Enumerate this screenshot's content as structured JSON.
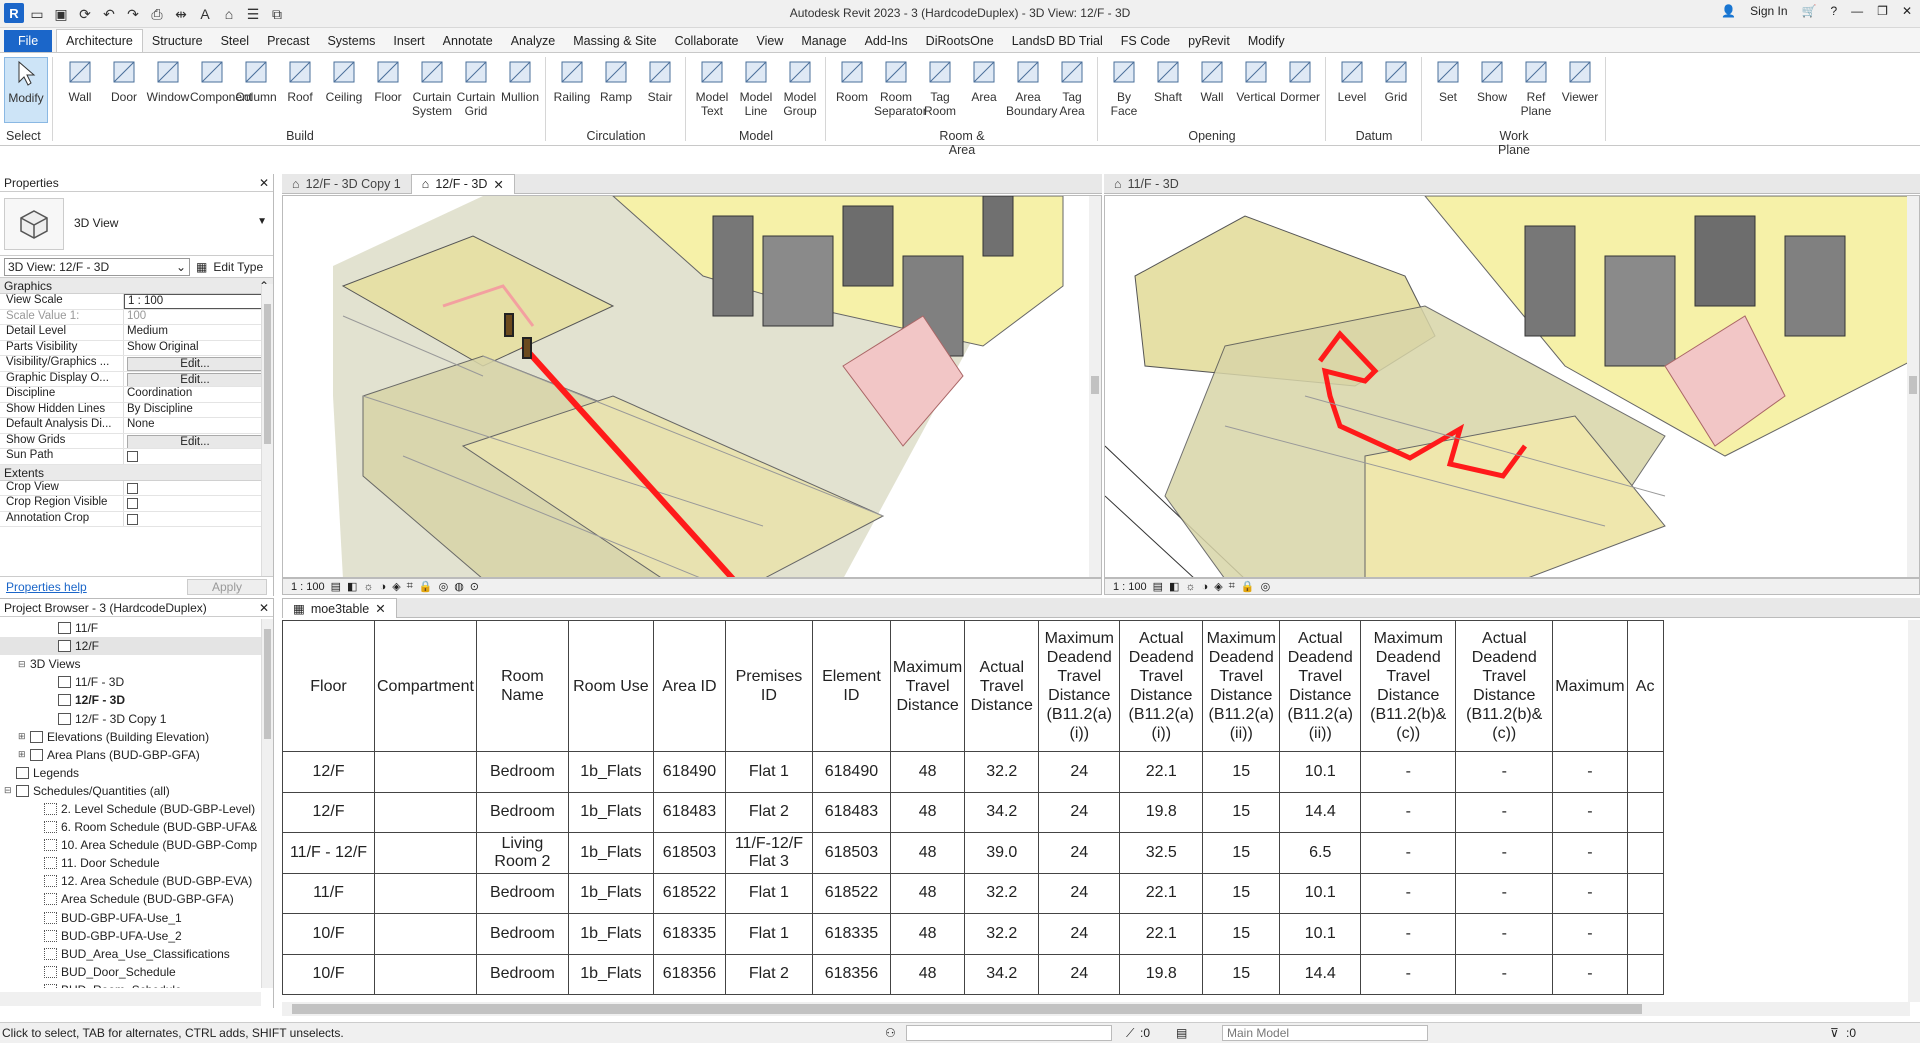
{
  "app": {
    "title": "Autodesk Revit 2023 - 3 (HardcodeDuplex) - 3D View: 12/F - 3D",
    "sign_in": "Sign In",
    "logo": "R"
  },
  "tabs": [
    "File",
    "Architecture",
    "Structure",
    "Steel",
    "Precast",
    "Systems",
    "Insert",
    "Annotate",
    "Analyze",
    "Massing & Site",
    "Collaborate",
    "View",
    "Manage",
    "Add-Ins",
    "DiRootsOne",
    "LandsD BD Trial",
    "FS Code",
    "pyRevit",
    "Modify"
  ],
  "ribbon": {
    "select_label": "Select",
    "panels": [
      {
        "label": "Build",
        "buttons": [
          "Wall",
          "Door",
          "Window",
          "Component",
          "Column",
          "Roof",
          "Ceiling",
          "Floor",
          "Curtain\nSystem",
          "Curtain\nGrid",
          "Mullion"
        ]
      },
      {
        "label": "Circulation",
        "buttons": [
          "Railing",
          "Ramp",
          "Stair"
        ]
      },
      {
        "label": "Model",
        "buttons": [
          "Model\nText",
          "Model\nLine",
          "Model\nGroup"
        ]
      },
      {
        "label": "Room & Area",
        "buttons": [
          "Room",
          "Room\nSeparator",
          "Tag\nRoom",
          "Area",
          "Area\nBoundary",
          "Tag\nArea"
        ]
      },
      {
        "label": "Opening",
        "buttons": [
          "By\nFace",
          "Shaft",
          "Wall",
          "Vertical",
          "Dormer"
        ]
      },
      {
        "label": "Datum",
        "buttons": [
          "Level",
          "Grid"
        ]
      },
      {
        "label": "Work Plane",
        "buttons": [
          "Set",
          "Show",
          "Ref\nPlane",
          "Viewer"
        ]
      }
    ],
    "modify": "Modify"
  },
  "properties": {
    "title": "Properties",
    "type_name": "3D View",
    "instance": "3D View: 12/F - 3D",
    "edit_type": "Edit Type",
    "groups": [
      {
        "name": "Graphics",
        "rows": [
          [
            "View Scale",
            "1 : 100"
          ],
          [
            "Scale Value    1:",
            "100"
          ],
          [
            "Detail Level",
            "Medium"
          ],
          [
            "Parts Visibility",
            "Show Original"
          ],
          [
            "Visibility/Graphics ...",
            "Edit..."
          ],
          [
            "Graphic Display O...",
            "Edit..."
          ],
          [
            "Discipline",
            "Coordination"
          ],
          [
            "Show Hidden Lines",
            "By Discipline"
          ],
          [
            "Default Analysis Di...",
            "None"
          ],
          [
            "Show Grids",
            "Edit..."
          ],
          [
            "Sun Path",
            ""
          ]
        ]
      },
      {
        "name": "Extents",
        "rows": [
          [
            "Crop View",
            ""
          ],
          [
            "Crop Region Visible",
            ""
          ],
          [
            "Annotation Crop",
            ""
          ]
        ]
      }
    ],
    "help": "Properties help",
    "apply": "Apply"
  },
  "browser": {
    "title": "Project Browser - 3 (HardcodeDuplex)",
    "nodes": [
      {
        "t": "11/F",
        "lvl": 3
      },
      {
        "t": "12/F",
        "lvl": 3,
        "sel": true
      },
      {
        "t": "3D Views",
        "lvl": 1,
        "exp": "-"
      },
      {
        "t": "11/F - 3D",
        "lvl": 3
      },
      {
        "t": "12/F - 3D",
        "lvl": 3,
        "bold": true
      },
      {
        "t": "12/F - 3D Copy 1",
        "lvl": 3
      },
      {
        "t": "Elevations (Building Elevation)",
        "lvl": 1,
        "exp": "+"
      },
      {
        "t": "Area Plans (BUD-GBP-GFA)",
        "lvl": 1,
        "exp": "+"
      },
      {
        "t": "Legends",
        "lvl": 0,
        "icon": true
      },
      {
        "t": "Schedules/Quantities (all)",
        "lvl": 0,
        "exp": "-",
        "icon": true
      },
      {
        "t": "2. Level Schedule (BUD-GBP-Level)",
        "lvl": 2,
        "sheet": true
      },
      {
        "t": "6. Room Schedule (BUD-GBP-UFA&",
        "lvl": 2,
        "sheet": true
      },
      {
        "t": "10. Area Schedule (BUD-GBP-Comp",
        "lvl": 2,
        "sheet": true
      },
      {
        "t": "11. Door Schedule",
        "lvl": 2,
        "sheet": true
      },
      {
        "t": "12. Area Schedule (BUD-GBP-EVA)",
        "lvl": 2,
        "sheet": true
      },
      {
        "t": "Area Schedule (BUD-GBP-GFA)",
        "lvl": 2,
        "sheet": true
      },
      {
        "t": "BUD-GBP-UFA-Use_1",
        "lvl": 2,
        "sheet": true
      },
      {
        "t": "BUD-GBP-UFA-Use_2",
        "lvl": 2,
        "sheet": true
      },
      {
        "t": "BUD_Area_Use_Classifications",
        "lvl": 2,
        "sheet": true
      },
      {
        "t": "BUD_Door_Schedule",
        "lvl": 2,
        "sheet": true
      },
      {
        "t": "BUD_Room_Schedule",
        "lvl": 2,
        "sheet": true
      }
    ]
  },
  "views": {
    "left_tabs": [
      "12/F - 3D Copy 1",
      "12/F - 3D"
    ],
    "right_tabs": [
      "11/F - 3D"
    ],
    "scale": "1 : 100"
  },
  "schedule": {
    "tab": "moe3table",
    "columns": [
      "Floor",
      "Compartment",
      "Room Name",
      "Room Use",
      "Area ID",
      "Premises ID",
      "Element ID",
      "Maximum Travel Distance",
      "Actual Travel Distance",
      "Maximum Deadend Travel Distance (B11.2(a)(i))",
      "Actual Deadend Travel Distance (B11.2(a)(i))",
      "Maximum Deadend Travel Distance (B11.2(a)(ii))",
      "Actual Deadend Travel Distance (B11.2(a)(ii))",
      "Maximum Deadend Travel Distance (B11.2(b)&(c))",
      "Actual Deadend Travel Distance (B11.2(b)&(c))",
      "Maximum",
      "Ac"
    ],
    "rows": [
      [
        "12/F",
        "",
        "Bedroom",
        "1b_Flats",
        "618490",
        "Flat 1",
        "618490",
        "48",
        "32.2",
        "24",
        "22.1",
        "15",
        "10.1",
        "-",
        "-",
        "-",
        ""
      ],
      [
        "12/F",
        "",
        "Bedroom",
        "1b_Flats",
        "618483",
        "Flat 2",
        "618483",
        "48",
        "34.2",
        "24",
        "19.8",
        "15",
        "14.4",
        "-",
        "-",
        "-",
        ""
      ],
      [
        "11/F - 12/F",
        "",
        "Living Room 2",
        "1b_Flats",
        "618503",
        "11/F-12/F Flat 3",
        "618503",
        "48",
        "39.0",
        "24",
        "32.5",
        "15",
        "6.5",
        "-",
        "-",
        "-",
        ""
      ],
      [
        "11/F",
        "",
        "Bedroom",
        "1b_Flats",
        "618522",
        "Flat 1",
        "618522",
        "48",
        "32.2",
        "24",
        "22.1",
        "15",
        "10.1",
        "-",
        "-",
        "-",
        ""
      ],
      [
        "10/F",
        "",
        "Bedroom",
        "1b_Flats",
        "618335",
        "Flat 1",
        "618335",
        "48",
        "32.2",
        "24",
        "22.1",
        "15",
        "10.1",
        "-",
        "-",
        "-",
        ""
      ],
      [
        "10/F",
        "",
        "Bedroom",
        "1b_Flats",
        "618356",
        "Flat 2",
        "618356",
        "48",
        "34.2",
        "24",
        "19.8",
        "15",
        "14.4",
        "-",
        "-",
        "-",
        ""
      ]
    ]
  },
  "status": {
    "text": "Click to select, TAB for alternates, CTRL adds, SHIFT unselects.",
    "model": "Main Model",
    "count": ":0",
    "filter": ":0"
  },
  "colors": {
    "accent": "#1b66c9",
    "route": "#ff1a1a",
    "floor": "#f7f2b0"
  }
}
